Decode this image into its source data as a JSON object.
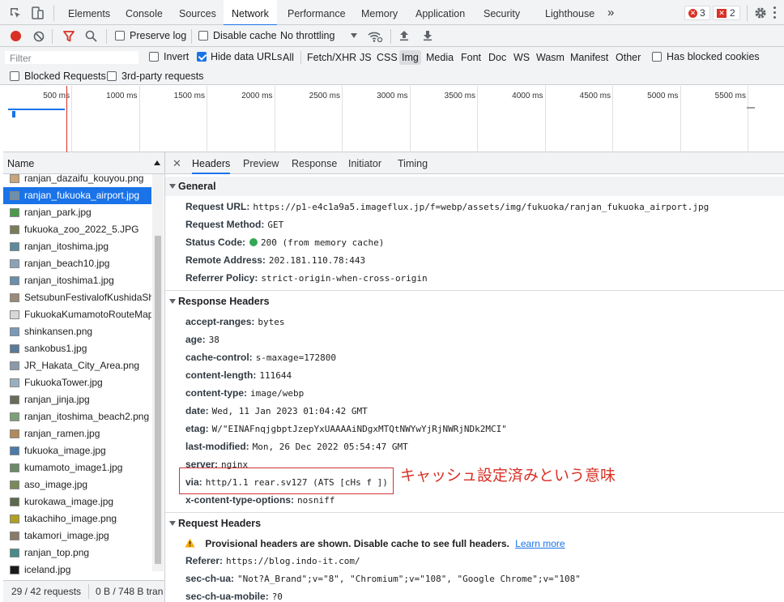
{
  "tabs": [
    "Elements",
    "Console",
    "Sources",
    "Network",
    "Performance",
    "Memory",
    "Application",
    "Security",
    "Lighthouse"
  ],
  "more_tabs": "»",
  "errors": {
    "count": "3",
    "color": "#d93025"
  },
  "warnings": {
    "count": "2",
    "color": "#d93025"
  },
  "toolbar": {
    "preserve_log": "Preserve log",
    "disable_cache": "Disable cache",
    "throttling": "No throttling"
  },
  "filter": {
    "placeholder": "Filter",
    "invert": "Invert",
    "hide_data_urls": "Hide data URLs",
    "types": [
      "All",
      "Fetch/XHR",
      "JS",
      "CSS",
      "Img",
      "Media",
      "Font",
      "Doc",
      "WS",
      "Wasm",
      "Manifest",
      "Other"
    ],
    "active_type": "Img",
    "blocked_cookies": "Has blocked cookies",
    "blocked_requests": "Blocked Requests",
    "third_party": "3rd-party requests"
  },
  "timeline": {
    "ticks": [
      "500 ms",
      "1000 ms",
      "1500 ms",
      "2000 ms",
      "2500 ms",
      "3000 ms",
      "3500 ms",
      "4000 ms",
      "4500 ms",
      "5000 ms",
      "5500 ms"
    ]
  },
  "list": {
    "header": "Name",
    "items": [
      "ranjan_dazaifu_kouyou.png",
      "ranjan_fukuoka_airport.jpg",
      "ranjan_park.jpg",
      "fukuoka_zoo_2022_5.JPG",
      "ranjan_itoshima.jpg",
      "ranjan_beach10.jpg",
      "ranjan_itoshima1.jpg",
      "SetsubunFestivalofKushidaShrine",
      "FukuokaKumamotoRouteMap",
      "shinkansen.png",
      "sankobus1.jpg",
      "JR_Hakata_City_Area.png",
      "FukuokaTower.jpg",
      "ranjan_jinja.jpg",
      "ranjan_itoshima_beach2.png",
      "ranjan_ramen.jpg",
      "fukuoka_image.jpg",
      "kumamoto_image1.jpg",
      "aso_image.jpg",
      "kurokawa_image.jpg",
      "takachiho_image.png",
      "takamori_image.jpg",
      "ranjan_top.png",
      "iceland.jpg"
    ],
    "selected_index": 1,
    "status_requests": "29 / 42 requests",
    "status_transfer": "0 B / 748 B tran"
  },
  "detail_tabs": [
    "Headers",
    "Preview",
    "Response",
    "Initiator",
    "Timing"
  ],
  "general": {
    "title": "General",
    "rows": [
      {
        "k": "Request URL:",
        "v": "https://p1-e4c1a9a5.imageflux.jp/f=webp/assets/img/fukuoka/ranjan_fukuoka_airport.jpg"
      },
      {
        "k": "Request Method:",
        "v": "GET"
      },
      {
        "k": "Status Code:",
        "v": "200  (from memory cache)"
      },
      {
        "k": "Remote Address:",
        "v": "202.181.110.78:443"
      },
      {
        "k": "Referrer Policy:",
        "v": "strict-origin-when-cross-origin"
      }
    ]
  },
  "response_headers": {
    "title": "Response Headers",
    "rows": [
      {
        "k": "accept-ranges:",
        "v": "bytes"
      },
      {
        "k": "age:",
        "v": "38"
      },
      {
        "k": "cache-control:",
        "v": "s-maxage=172800"
      },
      {
        "k": "content-length:",
        "v": "111644"
      },
      {
        "k": "content-type:",
        "v": "image/webp"
      },
      {
        "k": "date:",
        "v": "Wed, 11 Jan 2023 01:04:42 GMT"
      },
      {
        "k": "etag:",
        "v": "W/\"EINAFnqjgbptJzepYxUAAAAiNDgxMTQtNWYwYjRjNWRjNDk2MCI\""
      },
      {
        "k": "last-modified:",
        "v": "Mon, 26 Dec 2022 05:54:47 GMT"
      },
      {
        "k": "server:",
        "v": "nginx"
      },
      {
        "k": "via:",
        "v": "http/1.1 rear.sv127 (ATS [cHs f ])"
      },
      {
        "k": "x-content-type-options:",
        "v": "nosniff"
      }
    ]
  },
  "annotation": "キャッシュ設定済みという意味",
  "request_headers": {
    "title": "Request Headers",
    "warning": "Provisional headers are shown. Disable cache to see full headers.",
    "learn_more": "Learn more",
    "rows": [
      {
        "k": "Referer:",
        "v": "https://blog.indo-it.com/"
      },
      {
        "k": "sec-ch-ua:",
        "v": "\"Not?A_Brand\";v=\"8\", \"Chromium\";v=\"108\", \"Google Chrome\";v=\"108\""
      },
      {
        "k": "sec-ch-ua-mobile:",
        "v": "?0"
      }
    ]
  }
}
